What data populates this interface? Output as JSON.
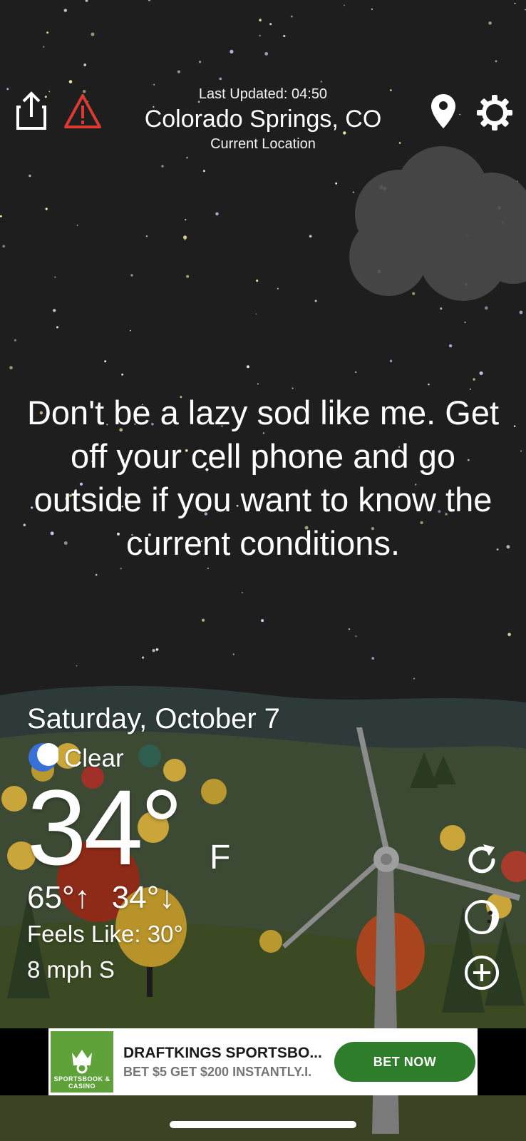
{
  "header": {
    "last_updated": "Last Updated: 04:50",
    "location_name": "Colorado Springs, CO",
    "location_sub": "Current Location",
    "left_icons": [
      "share-icon",
      "alert-icon"
    ],
    "right_icons": [
      "location-pin-icon",
      "gear-icon"
    ]
  },
  "message": {
    "text": "Don't be a lazy sod like me. Get off your cell phone and go outside if you want to know the current conditions."
  },
  "weather": {
    "date": "Saturday, October 7",
    "condition": "Clear",
    "condition_icon": "crescent-moon-icon",
    "temperature": "34°",
    "unit": "F",
    "high": "65°↑",
    "low": "34°↓",
    "feels_like": "Feels Like: 30°",
    "wind": "8 mph S"
  },
  "side_actions": [
    "refresh-icon",
    "moon-phase-icon",
    "add-icon"
  ],
  "ad": {
    "logo_text": "SPORTSBOOK & CASINO",
    "title": "DRAFTKINGS SPORTSBO...",
    "subtitle": "BET $5 GET $200 INSTANTLY.I.",
    "cta": "BET NOW"
  },
  "colors": {
    "sky": "#1e1e1e",
    "alert_red": "#d93a32",
    "ad_green": "#2d7d2a",
    "logo_green": "#5fa23a",
    "moon_blue": "#3a6fd8"
  }
}
